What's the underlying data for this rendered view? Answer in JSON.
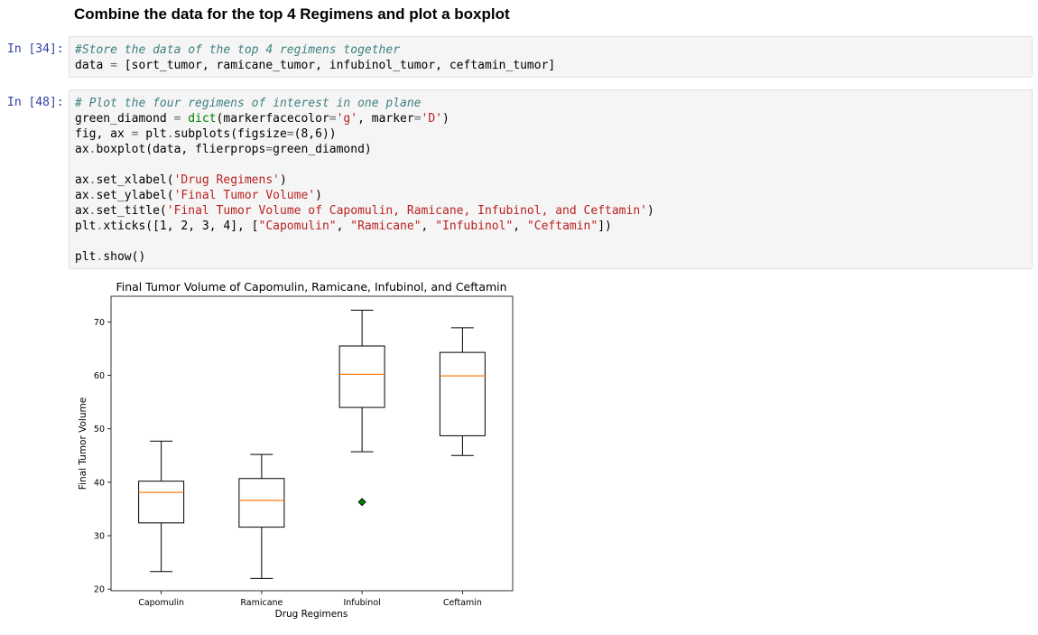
{
  "heading": "Combine the data for the top 4 Regimens and plot a boxplot",
  "cells": [
    {
      "prompt": "In [34]:",
      "lines": [
        [
          {
            "t": "#Store the data of the top 4 regimens together",
            "c": "c"
          }
        ],
        [
          {
            "t": "data ",
            "c": ""
          },
          {
            "t": "=",
            "c": "o"
          },
          {
            "t": " [sort_tumor, ramicane_tumor, infubinol_tumor, ceftamin_tumor]",
            "c": ""
          }
        ]
      ]
    },
    {
      "prompt": "In [48]:",
      "lines": [
        [
          {
            "t": "# Plot the four regimens of interest in one plane",
            "c": "c"
          }
        ],
        [
          {
            "t": "green_diamond ",
            "c": ""
          },
          {
            "t": "=",
            "c": "o"
          },
          {
            "t": " ",
            "c": ""
          },
          {
            "t": "dict",
            "c": "k"
          },
          {
            "t": "(markerfacecolor",
            "c": ""
          },
          {
            "t": "=",
            "c": "o"
          },
          {
            "t": "'g'",
            "c": "s"
          },
          {
            "t": ", marker",
            "c": ""
          },
          {
            "t": "=",
            "c": "o"
          },
          {
            "t": "'D'",
            "c": "s"
          },
          {
            "t": ")",
            "c": ""
          }
        ],
        [
          {
            "t": "fig, ax ",
            "c": ""
          },
          {
            "t": "=",
            "c": "o"
          },
          {
            "t": " plt",
            "c": ""
          },
          {
            "t": ".",
            "c": "o"
          },
          {
            "t": "subplots(figsize",
            "c": ""
          },
          {
            "t": "=",
            "c": "o"
          },
          {
            "t": "(8,6))",
            "c": ""
          }
        ],
        [
          {
            "t": "ax",
            "c": ""
          },
          {
            "t": ".",
            "c": "o"
          },
          {
            "t": "boxplot(data, flierprops",
            "c": ""
          },
          {
            "t": "=",
            "c": "o"
          },
          {
            "t": "green_diamond)",
            "c": ""
          }
        ],
        [],
        [
          {
            "t": "ax",
            "c": ""
          },
          {
            "t": ".",
            "c": "o"
          },
          {
            "t": "set_xlabel(",
            "c": ""
          },
          {
            "t": "'Drug Regimens'",
            "c": "s"
          },
          {
            "t": ")",
            "c": ""
          }
        ],
        [
          {
            "t": "ax",
            "c": ""
          },
          {
            "t": ".",
            "c": "o"
          },
          {
            "t": "set_ylabel(",
            "c": ""
          },
          {
            "t": "'Final Tumor Volume'",
            "c": "s"
          },
          {
            "t": ")",
            "c": ""
          }
        ],
        [
          {
            "t": "ax",
            "c": ""
          },
          {
            "t": ".",
            "c": "o"
          },
          {
            "t": "set_title(",
            "c": ""
          },
          {
            "t": "'Final Tumor Volume of Capomulin, Ramicane, Infubinol, and Ceftamin'",
            "c": "s"
          },
          {
            "t": ")",
            "c": ""
          }
        ],
        [
          {
            "t": "plt",
            "c": ""
          },
          {
            "t": ".",
            "c": "o"
          },
          {
            "t": "xticks([1, 2, 3, 4], [",
            "c": ""
          },
          {
            "t": "\"Capomulin\"",
            "c": "s"
          },
          {
            "t": ", ",
            "c": ""
          },
          {
            "t": "\"Ramicane\"",
            "c": "s"
          },
          {
            "t": ", ",
            "c": ""
          },
          {
            "t": "\"Infubinol\"",
            "c": "s"
          },
          {
            "t": ", ",
            "c": ""
          },
          {
            "t": "\"Ceftamin\"",
            "c": "s"
          },
          {
            "t": "])",
            "c": ""
          }
        ],
        [],
        [
          {
            "t": "plt",
            "c": ""
          },
          {
            "t": ".",
            "c": "o"
          },
          {
            "t": "show()",
            "c": ""
          }
        ]
      ]
    }
  ],
  "colors": {
    "median": "#ff7f0e",
    "flier_face": "#008000",
    "box": "#000000"
  },
  "chart_data": {
    "type": "boxplot",
    "title": "Final Tumor Volume of Capomulin, Ramicane, Infubinol, and Ceftamin",
    "xlabel": "Drug Regimens",
    "ylabel": "Final Tumor Volume",
    "categories": [
      "Capomulin",
      "Ramicane",
      "Infubinol",
      "Ceftamin"
    ],
    "yticks": [
      20,
      30,
      40,
      50,
      60,
      70
    ],
    "ylim": [
      19.7,
      74.8
    ],
    "boxes": [
      {
        "name": "Capomulin",
        "whislo": 23.3,
        "q1": 32.4,
        "med": 38.1,
        "q3": 40.2,
        "whishi": 47.7,
        "fliers": []
      },
      {
        "name": "Ramicane",
        "whislo": 22.0,
        "q1": 31.6,
        "med": 36.6,
        "q3": 40.7,
        "whishi": 45.2,
        "fliers": []
      },
      {
        "name": "Infubinol",
        "whislo": 45.7,
        "q1": 54.0,
        "med": 60.2,
        "q3": 65.5,
        "whishi": 72.2,
        "fliers": [
          36.3
        ]
      },
      {
        "name": "Ceftamin",
        "whislo": 45.0,
        "q1": 48.7,
        "med": 59.9,
        "q3": 64.3,
        "whishi": 68.9,
        "fliers": []
      }
    ],
    "grid": false
  }
}
